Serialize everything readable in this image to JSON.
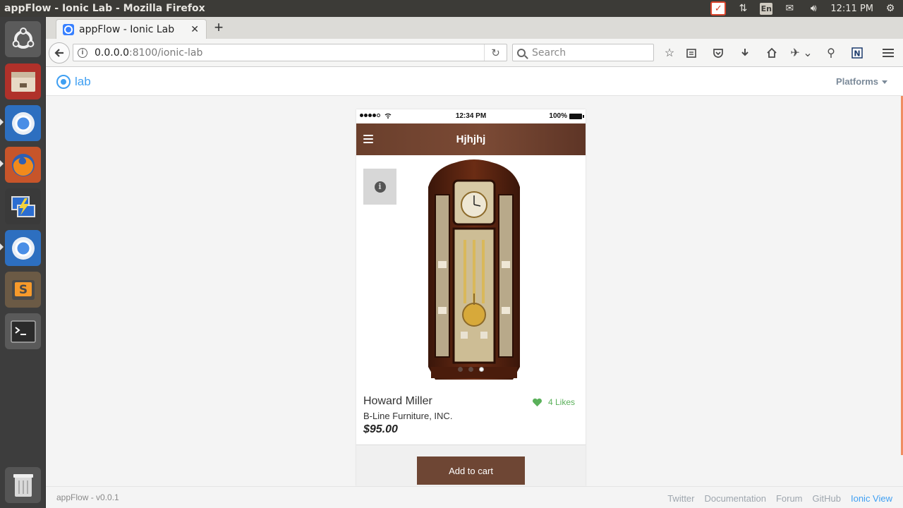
{
  "os": {
    "window_title": "appFlow - Ionic Lab - Mozilla Firefox",
    "clock": "12:11 PM",
    "lang": "En"
  },
  "browser": {
    "tab_title": "appFlow - Ionic Lab",
    "url_host": "0.0.0.0",
    "url_rest": ":8100/ionic-lab",
    "search_placeholder": "Search"
  },
  "lab": {
    "logo_text": "lab",
    "platforms_label": "Platforms",
    "version": "appFlow - v0.0.1",
    "footer_links": [
      "Twitter",
      "Documentation",
      "Forum",
      "GitHub",
      "Ionic View"
    ]
  },
  "device": {
    "status_time": "12:34 PM",
    "battery": "100%",
    "app_title": "Hjhjhj",
    "slides_total": 3,
    "active_slide": 3
  },
  "product": {
    "name": "Howard Miller",
    "brand": "B-Line Furniture, INC.",
    "price": "$95.00",
    "likes": "4 Likes",
    "add_to_cart": "Add to cart"
  },
  "colors": {
    "ionic_blue": "#3f9ff2",
    "toolbar_brown": "#6a3f2c",
    "cart_button": "#6e4634",
    "like_green": "#5ab05a",
    "scroll_accent": "#f08d61"
  }
}
